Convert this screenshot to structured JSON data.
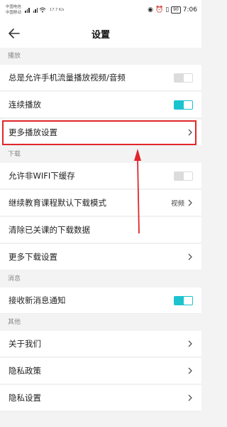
{
  "status_bar": {
    "carrier_1": "中国电信",
    "carrier_2": "中国移动",
    "network_speed": "17.7 K/s",
    "battery": "90",
    "time": "7:06"
  },
  "header": {
    "title": "设置"
  },
  "sections": {
    "playback": "播放",
    "download": "下载",
    "messages": "消息",
    "other": "其他"
  },
  "rows": {
    "mobile_data_play": {
      "label": "总是允许手机流量播放视频/音频",
      "toggle": "off"
    },
    "continuous_play": {
      "label": "连续播放",
      "toggle": "on"
    },
    "more_playback": {
      "label": "更多播放设置"
    },
    "non_wifi_cache": {
      "label": "允许非WIFI下缓存",
      "toggle": "off"
    },
    "default_download_mode": {
      "label": "继续教育课程默认下载模式",
      "value": "视频"
    },
    "clear_downloads": {
      "label": "清除已关课的下载数据"
    },
    "more_download": {
      "label": "更多下载设置"
    },
    "new_message_notify": {
      "label": "接收新消息通知",
      "toggle": "on"
    },
    "about_us": {
      "label": "关于我们"
    },
    "privacy_policy": {
      "label": "隐私政策"
    },
    "privacy_settings": {
      "label": "隐私设置"
    }
  },
  "colors": {
    "accent": "#1bc3cf",
    "annotation": "#e0262a"
  }
}
